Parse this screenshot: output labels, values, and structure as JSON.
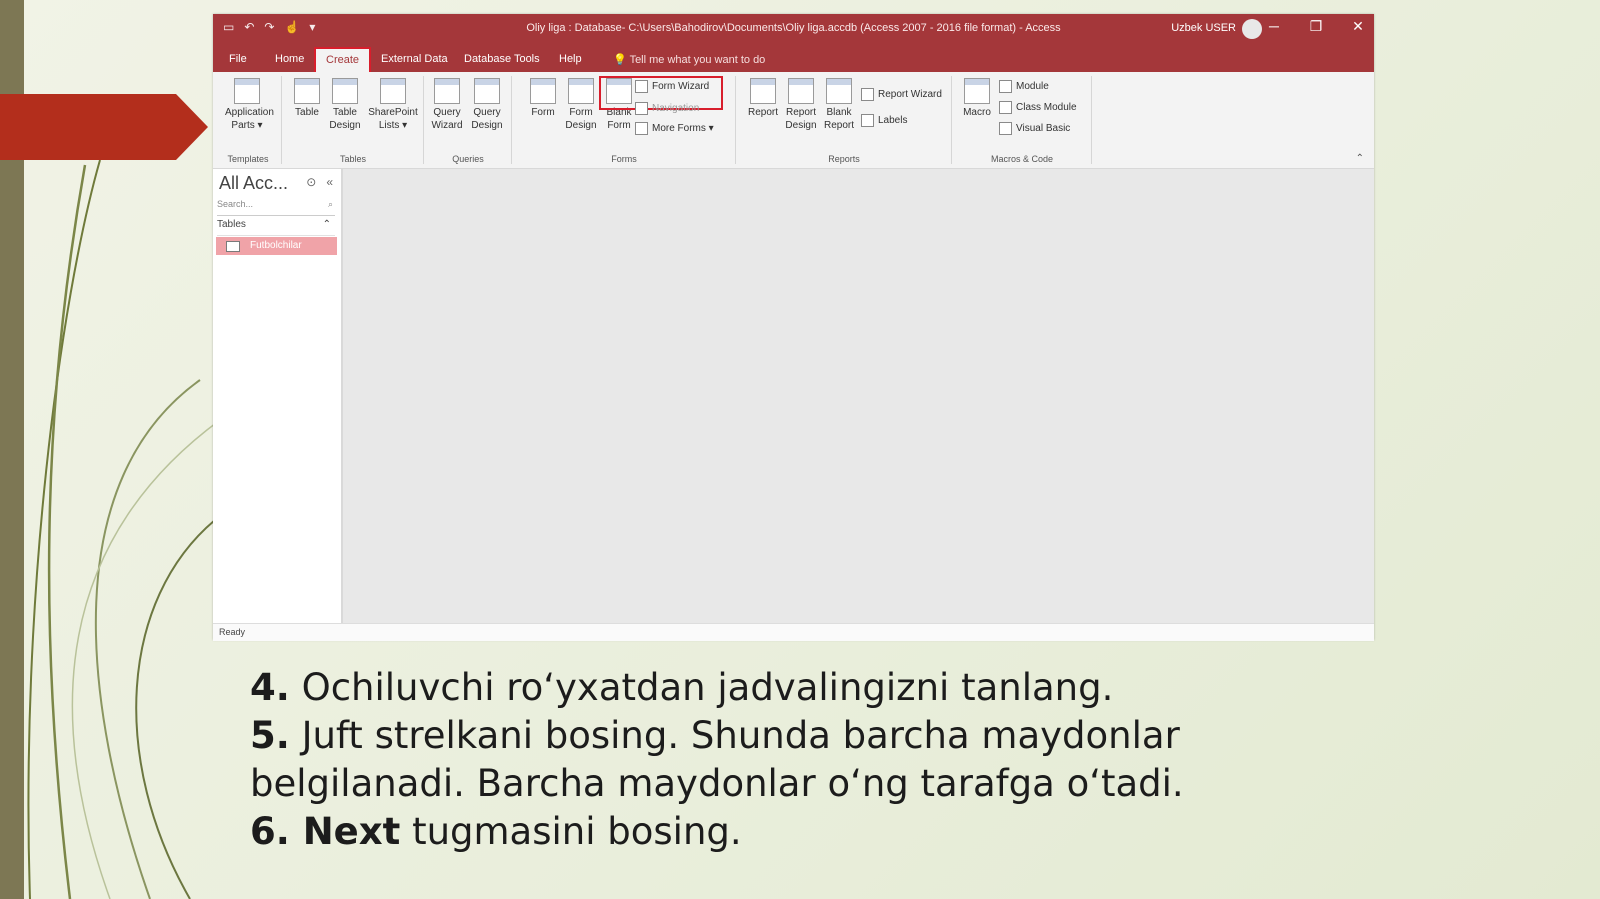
{
  "window": {
    "title": "Oliy liga : Database- C:\\Users\\Bahodirov\\Documents\\Oliy liga.accdb (Access 2007 - 2016 file format) - Access",
    "user": "Uzbek USER",
    "qat_icons": [
      "save-icon",
      "undo-icon",
      "redo-icon",
      "touch-mode-icon"
    ],
    "controls": {
      "minimize": "─",
      "restore": "❐",
      "close": "✕"
    }
  },
  "tabs": [
    "File",
    "Home",
    "Create",
    "External Data",
    "Database Tools",
    "Help"
  ],
  "active_tab": "Create",
  "tell_me": "Tell me what you want to do",
  "ribbon": {
    "templates": {
      "label": "Templates",
      "buttons": [
        "Application Parts ▾"
      ]
    },
    "tables": {
      "label": "Tables",
      "buttons": [
        "Table",
        "Table Design",
        "SharePoint Lists ▾"
      ]
    },
    "queries": {
      "label": "Queries",
      "buttons": [
        "Query Wizard",
        "Query Design"
      ]
    },
    "forms": {
      "label": "Forms",
      "buttons": [
        "Form",
        "Form Design",
        "Blank Form"
      ],
      "small": [
        "Form Wizard",
        "Navigation",
        "More Forms ▾"
      ]
    },
    "reports": {
      "label": "Reports",
      "buttons": [
        "Report",
        "Report Design",
        "Blank Report"
      ],
      "small": [
        "Report Wizard",
        "Labels"
      ]
    },
    "macros": {
      "label": "Macros & Code",
      "buttons": [
        "Macro"
      ],
      "small": [
        "Module",
        "Class Module",
        "Visual Basic"
      ]
    }
  },
  "nav": {
    "title": "All Acc...",
    "search_placeholder": "Search...",
    "section": "Tables",
    "item": "Futbolchilar"
  },
  "status": "Ready",
  "instructions": [
    {
      "num": "4.",
      "text": " Ochiluvchi ro‘yxatdan jadvalingizni tanlang."
    },
    {
      "num": "5.",
      "text": " Juft strelkani bosing. Shunda barcha maydonlar belgilanadi. Barcha maydonlar o‘ng tarafga o‘tadi."
    },
    {
      "num": "6.",
      "bold": " Next",
      "text": " tugmasini bosing."
    }
  ],
  "colors": {
    "title_bar": "#a4373a",
    "highlight": "#d81e2c",
    "arrow": "#b32e1c",
    "nav_selected": "#f0a3a8"
  }
}
